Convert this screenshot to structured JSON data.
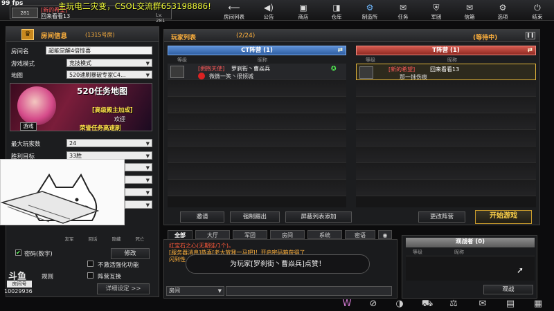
{
  "fps": "99 fps",
  "banner": "主玩电二灾变，CSOL交流群653198886!",
  "user": {
    "rank": "281",
    "tag": "[新的希望]",
    "name": "回来看看13",
    "level": "Lv. 281"
  },
  "nav": [
    {
      "label": "房间列表",
      "icon": "back-arrow-icon"
    },
    {
      "label": "公告",
      "icon": "megaphone-icon"
    },
    {
      "label": "商店",
      "icon": "shop-icon"
    },
    {
      "label": "仓库",
      "icon": "storage-icon"
    },
    {
      "label": "制造所",
      "icon": "craft-icon"
    },
    {
      "label": "任务",
      "icon": "mission-icon"
    },
    {
      "label": "军团",
      "icon": "clan-icon"
    },
    {
      "label": "信箱",
      "icon": "mail-icon"
    },
    {
      "label": "选项",
      "icon": "gear-icon"
    },
    {
      "label": "结束",
      "icon": "power-icon"
    }
  ],
  "room": {
    "title": "房间信息",
    "number": "(1315号房)",
    "name_label": "房间名",
    "name_value": "超能觉醒4倍惊喜",
    "mode_label": "游戏模式",
    "mode_value": "竞技模式",
    "map_label": "地图",
    "map_value": "520速刷暴破专家C4...",
    "map_image_title": "520任务地图",
    "map_image_sub": "[高级殿主加成]",
    "map_image_badge": "游戏",
    "map_image_welcome": "欢迎",
    "map_image_footer": "荣誉任务高速刷",
    "max_players_label": "最大玩家数",
    "max_players_value": "24",
    "win_target_label": "胜利目标",
    "win_target_value": "33胜",
    "password_label": "密码(数字)",
    "modify_label": "修改",
    "no_enhance_label": "不激活强化功能",
    "rules_label": "规则",
    "team_swap_label": "阵营互换",
    "details_label": "详细设定 >>",
    "small_btns": [
      "友军",
      "回话",
      "隐藏",
      "死亡"
    ]
  },
  "players": {
    "title": "玩家列表",
    "count": "(2/24)",
    "status": "(等待中)",
    "ct_title": "CT阵营 (1)",
    "t_title": "T阵营 (1)",
    "col_rank": "等级",
    "col_name": "昵称",
    "ct_player": {
      "tag": "[拥抱天使]",
      "name": "罗刹街丶曹焱兵",
      "sub": "微微一笑丶很倾城"
    },
    "t_player": {
      "tag": "[新的希望]",
      "name": "回来看看13",
      "sub": "那一抹伤痕"
    }
  },
  "actions": {
    "invite": "邀请",
    "kick": "强制踢出",
    "block": "屏蔽列表添加",
    "change_team": "更改阵营",
    "start": "开始游戏"
  },
  "chat": {
    "tabs": [
      "全部",
      "大厅",
      "军团",
      "房间",
      "系统",
      "密语"
    ],
    "lines": [
      {
        "text": "红宝石之心(无期徒/1个)。",
        "color": "#ff5a3a"
      },
      {
        "text": "[服务器消息]恭喜[老大放我一马吧]！开启密码箱获得了",
        "color": "#ffb13d"
      },
      {
        "text": "闪到性",
        "color": "#ffb13d"
      }
    ],
    "toast": "为玩家[罗刹街丶曹焱兵]点赞！",
    "scope": "房间"
  },
  "spectators": {
    "title": "观战者 (0)",
    "col_rank": "等级",
    "col_name": "昵称",
    "btn": "观战"
  },
  "stream": {
    "platform": "斗鱼",
    "room_label": "房间号",
    "room_id": "10029936"
  }
}
